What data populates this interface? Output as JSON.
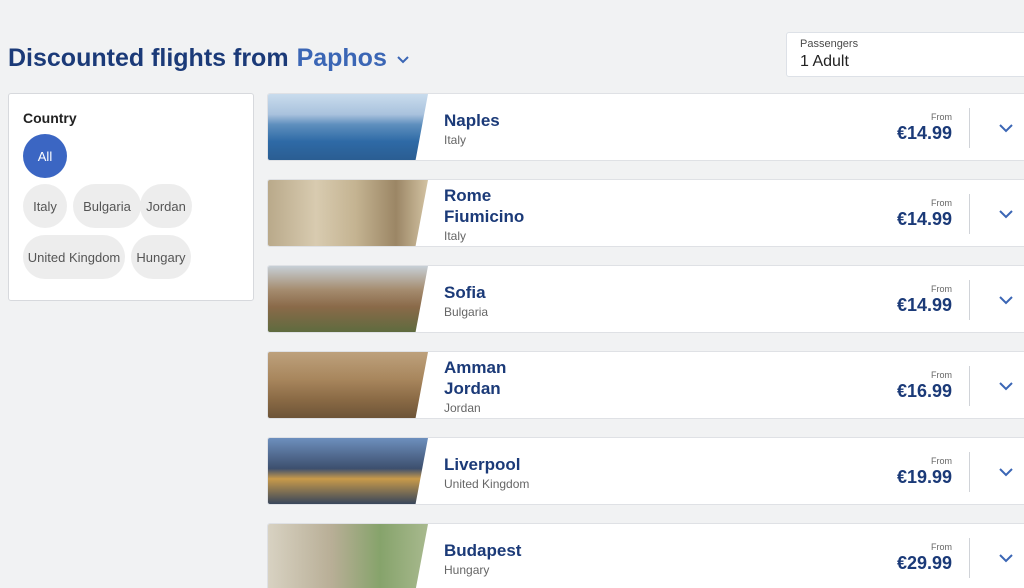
{
  "header": {
    "title_prefix": "Discounted flights from",
    "origin_city": "Paphos"
  },
  "passengers": {
    "label": "Passengers",
    "value": "1 Adult"
  },
  "filter": {
    "title": "Country",
    "chips": [
      {
        "label": "All",
        "active": true
      },
      {
        "label": "Italy",
        "active": false
      },
      {
        "label": "Bulgaria",
        "active": false
      },
      {
        "label": "Jordan",
        "active": false
      },
      {
        "label": "United Kingdom",
        "active": false
      },
      {
        "label": "Hungary",
        "active": false
      }
    ]
  },
  "destinations": [
    {
      "city": "Naples",
      "country": "Italy",
      "from_label": "From",
      "price": "€14.99"
    },
    {
      "city": "Rome Fiumicino",
      "country": "Italy",
      "from_label": "From",
      "price": "€14.99"
    },
    {
      "city": "Sofia",
      "country": "Bulgaria",
      "from_label": "From",
      "price": "€14.99"
    },
    {
      "city": "Amman Jordan",
      "country": "Jordan",
      "from_label": "From",
      "price": "€16.99"
    },
    {
      "city": "Liverpool",
      "country": "United Kingdom",
      "from_label": "From",
      "price": "€19.99"
    },
    {
      "city": "Budapest",
      "country": "Hungary",
      "from_label": "From",
      "price": "€29.99"
    }
  ],
  "colors": {
    "brand_navy": "#1b3a78",
    "accent_blue": "#3b66c3",
    "background": "#f1f2f3"
  },
  "icons": {
    "origin_dropdown": "chevron-down-icon",
    "card_expand": "chevron-down-icon"
  }
}
